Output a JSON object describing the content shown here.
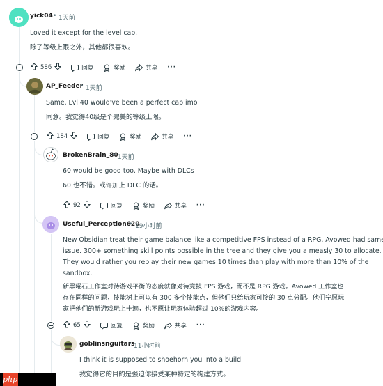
{
  "comments": [
    {
      "author": "yick04",
      "time": "1天前",
      "text_en": "Loved it except for the level cap.",
      "text_zh": "除了等级上限之外，其他都很喜欢。",
      "votes": "586",
      "reply": "回复",
      "award": "奖励",
      "share": "共享",
      "more": "···"
    },
    {
      "author": "AP_Feeder",
      "time": "1天前",
      "text_en": "Same. Lvl 40 would've been a perfect cap imo",
      "text_zh": "同意。我觉得40级是个完美的等级上限。",
      "votes": "184",
      "reply": "回复",
      "award": "奖励",
      "share": "共享",
      "more": "···"
    },
    {
      "author": "BrokenBrain_80",
      "time": "1天前",
      "text_en": "60 would be good too. Maybe with DLCs",
      "text_zh": "60 也不错。或许加上 DLC 的话。",
      "votes": "92",
      "reply": "回复",
      "award": "奖励",
      "share": "共享",
      "more": "···"
    },
    {
      "author": "Useful_Perception620",
      "time": "19小时前",
      "text_en_1": "New Obsidian treat their game balance like a competitive FPS instead of a RPG. Avowed had same",
      "text_en_2": "issue. 300+ something skill points possible in the tree and they give you a measly 30 to allocate.",
      "text_en_3": "They would rather you replay their new games 10 times than play with more than 10% of the",
      "text_en_4": "sandbox.",
      "text_zh_1": "新黑曜石工作室对待游戏平衡的态度就像对待竞技 FPS 游戏，而不是 RPG 游戏。Avowed 工作室也",
      "text_zh_2": "存在同样的问题，技能树上可以有 300 多个技能点，但他们只给玩家可怜的 30 点分配。他们宁愿玩",
      "text_zh_3": "家把他们的新游戏玩上十遍，也不愿让玩家体验超过 10%的游戏内容。",
      "votes": "65",
      "reply": "回复",
      "award": "奖励",
      "share": "共享",
      "more": "···"
    },
    {
      "author": "goblinsnguitars",
      "time": "11小时前",
      "text_en": "I think it is supposed to shoehorn you into a build.",
      "text_zh": "我觉得它的目的是强迫你接受某种特定的构建方式。"
    }
  ],
  "separator": "•",
  "watermark": "php",
  "colors": {
    "line": "#e5ebee",
    "meta": "#576f76",
    "avatar1": "#4fe1c1"
  },
  "icons": {
    "upvote": "arrow-up-icon",
    "downvote": "arrow-down-icon",
    "reply": "speech-bubble-icon",
    "award": "award-icon",
    "share": "share-icon"
  }
}
